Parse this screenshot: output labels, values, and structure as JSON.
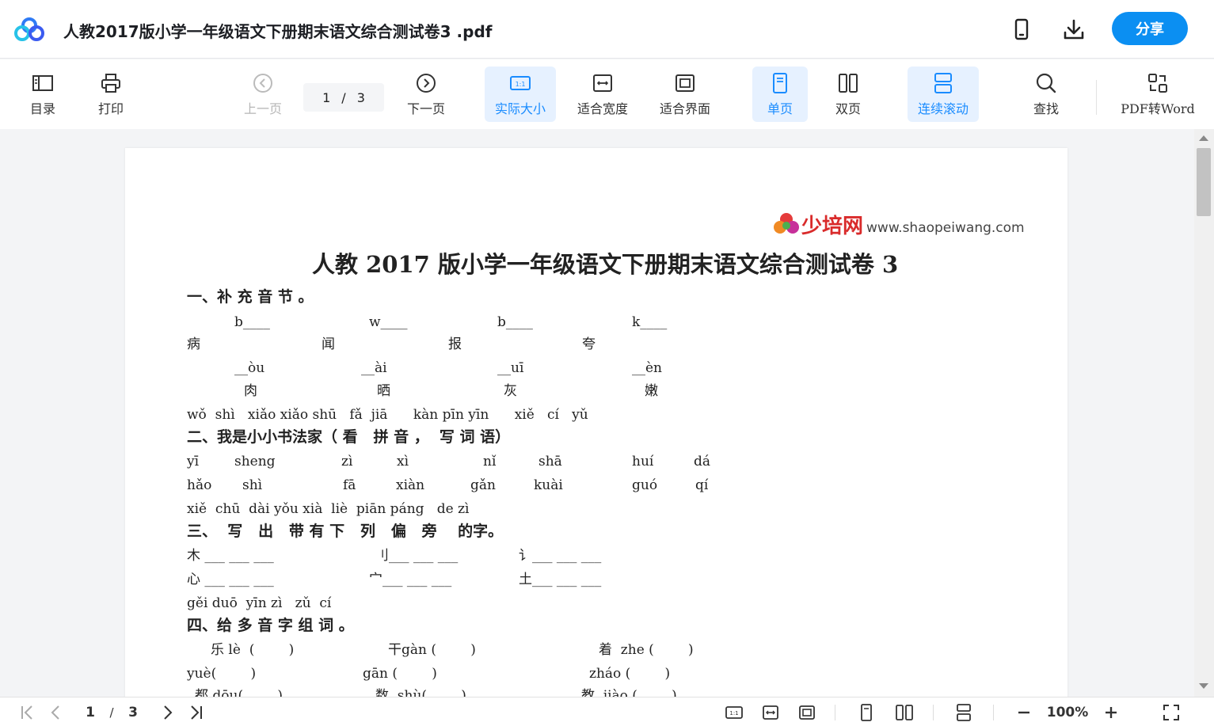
{
  "titlebar": {
    "title": "人教2017版小学一年级语文下册期末语文综合测试卷3 .pdf",
    "share_label": "分享"
  },
  "toolbar": {
    "toc_label": "目录",
    "print_label": "打印",
    "prev_label": "上一页",
    "next_label": "下一页",
    "current_page": "1",
    "separator": "/",
    "total_pages": "3",
    "actual_size_label": "实际大小",
    "fit_width_label": "适合宽度",
    "fit_page_label": "适合界面",
    "single_label": "单页",
    "double_label": "双页",
    "scroll_label": "连续滚动",
    "find_label": "查找",
    "convert_label": "PDF转Word"
  },
  "document": {
    "brand_name": "少培网",
    "brand_url": "www.shaopeiwang.com",
    "title": "人教 2017 版小学一年级语文下册期末语文综合测试卷 3",
    "lines": [
      "一、补 充 音 节 。",
      "b____",
      "w____",
      "b____",
      "k____",
      "病",
      "闻",
      "报",
      "夸",
      "__òu",
      "__ài",
      "__uī",
      "__èn",
      "肉",
      "晒",
      "灰",
      "嫩",
      "wǒ  shì   xiǎo xiǎo shū   fǎ  jiā      kàn pīn yīn      xiě   cí   yǔ",
      "二、我是小小书法家（ 看   拼 音 ，  写 词 语）",
      "yī",
      "sheng",
      "zì",
      "xì",
      "nǐ",
      "shā",
      "huí",
      "dá",
      "hǎo",
      "shì",
      "fā",
      "xiàn",
      "gǎn",
      "kuài",
      "guó",
      "qí",
      "xiě  chū  dài yǒu xià  liè  piān páng   de zì",
      "三、  写   出   带 有 下   列   偏   旁    的字。",
      "木 ___ ___ ___",
      "刂___ ___ ___",
      "讠___ ___ ___",
      "心 ___ ___ ___",
      "宀___ ___ ___",
      "土___ ___ ___",
      "gěi duō  yīn zì   zǔ  cí",
      "四、给 多 音 字 组 词 。",
      "乐 lè  (        )",
      "干gàn (        )",
      "着  zhe (        )",
      "yuè(        )",
      "gān (        )",
      "zháo (        )",
      "都 dōu(        )",
      "数  shù(        )",
      "教  jiào (        )"
    ]
  },
  "statusbar": {
    "current_page": "1",
    "separator": "/",
    "total_pages": "3",
    "zoom": "100%"
  }
}
